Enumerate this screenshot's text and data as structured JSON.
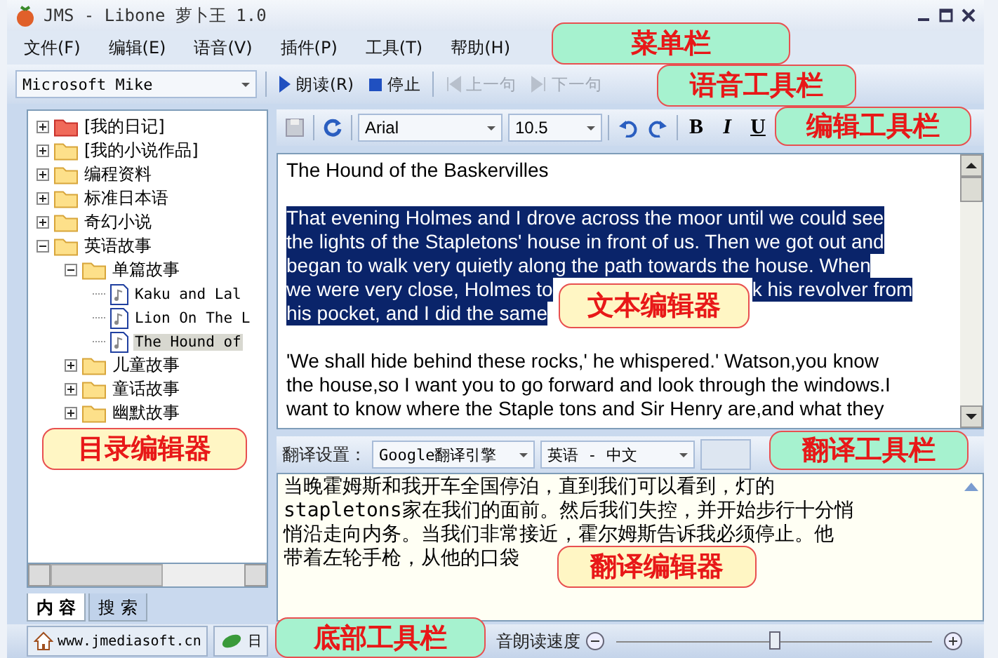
{
  "window": {
    "title": "JMS - Libone 萝卜王 1.0"
  },
  "menu_bar": {
    "items": [
      "文件(F)",
      "编辑(E)",
      "语音(V)",
      "插件(P)",
      "工具(T)",
      "帮助(H)"
    ],
    "callout": {
      "text": "菜单栏",
      "color": "#a6f2cf"
    }
  },
  "voice_toolbar": {
    "voice": "Microsoft Mike",
    "buttons": [
      {
        "label": "朗读(R)",
        "kind": "play",
        "disabled": false
      },
      {
        "label": "停止",
        "kind": "stop",
        "disabled": false
      },
      {
        "label": "上一句",
        "kind": "prev",
        "disabled": true
      },
      {
        "label": "下一句",
        "kind": "next",
        "disabled": true
      }
    ],
    "callout": {
      "text": "语音工具栏",
      "color": "#a6f2cf"
    }
  },
  "tree": {
    "items": [
      {
        "label": "[我的日记]",
        "kind": "diary",
        "expanded": false,
        "selected": false
      },
      {
        "label": "[我的小说作品]",
        "kind": "folder",
        "expanded": false,
        "selected": false
      },
      {
        "label": "编程资料",
        "kind": "folder",
        "expanded": false,
        "selected": false
      },
      {
        "label": "标准日本语",
        "kind": "folder",
        "expanded": false,
        "selected": false
      },
      {
        "label": "奇幻小说",
        "kind": "folder",
        "expanded": false,
        "selected": false
      },
      {
        "label": "英语故事",
        "kind": "folder",
        "expanded": true,
        "selected": false,
        "children": [
          {
            "label": "单篇故事",
            "kind": "folder",
            "expanded": true,
            "selected": false,
            "children": [
              {
                "label": "Kaku and Lal",
                "kind": "document",
                "selected": false
              },
              {
                "label": "Lion On The L",
                "kind": "document",
                "selected": false
              },
              {
                "label": "The Hound of",
                "kind": "document",
                "selected": true
              }
            ]
          },
          {
            "label": "儿童故事",
            "kind": "folder",
            "expanded": false,
            "selected": false
          },
          {
            "label": "童话故事",
            "kind": "folder",
            "expanded": false,
            "selected": false
          },
          {
            "label": "幽默故事",
            "kind": "folder",
            "expanded": false,
            "selected": false
          }
        ]
      }
    ],
    "tabs": [
      {
        "label": "内 容",
        "selected": true
      },
      {
        "label": "搜 索",
        "selected": false
      }
    ],
    "callout": {
      "text": "目录编辑器",
      "color": "#fff6c4"
    }
  },
  "edit_toolbar": {
    "font": "Arial",
    "size": "10.5",
    "buttons": [
      {
        "label": "B",
        "kind": "bold"
      },
      {
        "label": "I",
        "kind": "italic"
      },
      {
        "label": "U",
        "kind": "underline"
      }
    ],
    "callout": {
      "text": "编辑工具栏",
      "color": "#a6f2cf"
    }
  },
  "text_editor": {
    "title": "The Hound of the Baskervilles",
    "paragraphs": [
      {
        "selected": true,
        "lines": [
          "That evening Holmes and I drove across the moor until we could see",
          "the lights of the Stapletons' house in front of us. Then we got out and",
          "began to walk very quietly along the path towards the house. When",
          [
            "we were very close, Holmes to",
            "k his revolver from"
          ],
          [
            "his pocket, and I did the same"
          ]
        ]
      },
      {
        "selected": false,
        "lines": [
          "'We shall hide behind these rocks,' he whispered.' Watson,you know",
          "the house,so I want you to go forward and look through the windows.I",
          "want to know where the Staple tons and Sir Henry are,and what they"
        ]
      }
    ],
    "callout": {
      "text": "文本编辑器",
      "color": "#fff6c4"
    }
  },
  "translate_toolbar": {
    "label": "翻译设置：",
    "engine": "Google翻译引擎",
    "language": "英语 - 中文",
    "callout": {
      "text": "翻译工具栏",
      "color": "#a6f2cf"
    }
  },
  "translation_editor": {
    "lines": [
      "当晚霍姆斯和我开车全国停泊，直到我们可以看到，灯的",
      "stapletons家在我们的面前。然后我们失控，并开始步行十分悄",
      "悄沿走向内务。当我们非常接近，霍尔姆斯告诉我必须停止。他",
      "带着左轮手枪，从他的口袋"
    ],
    "callout": {
      "text": "翻译编辑器",
      "color": "#fff6c4"
    }
  },
  "bottom_bar": {
    "link": "www.jmediasoft.cn",
    "button": "日",
    "speed_label": "音朗读速度",
    "speed": {
      "level": 0.5
    },
    "callout": {
      "text": "底部工具栏",
      "color": "#a6f2cf"
    }
  }
}
